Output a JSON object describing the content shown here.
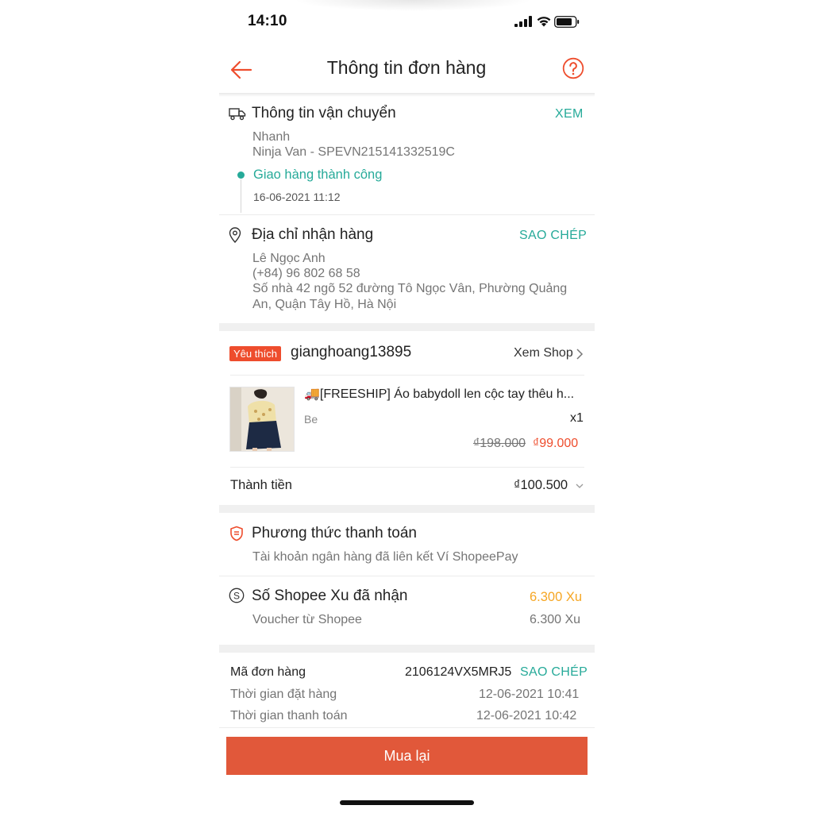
{
  "status_bar": {
    "time": "14:10"
  },
  "header": {
    "title": "Thông tin đơn hàng"
  },
  "shipping": {
    "title": "Thông tin vận chuyển",
    "action": "XEM",
    "method": "Nhanh",
    "carrier_tracking": "Ninja Van - SPEVN215141332519C",
    "status": "Giao hàng thành công",
    "status_time": "16-06-2021 11:12"
  },
  "address": {
    "title": "Địa chỉ nhận hàng",
    "action": "SAO CHÉP",
    "name": "Lê Ngọc Anh",
    "phone": "(+84) 96 802 68 58",
    "line1": "Số nhà 42 ngõ 52 đường Tô Ngọc Vân, Phường Quảng",
    "line2": "An, Quận Tây Hồ, Hà Nội"
  },
  "shop": {
    "badge": "Yêu thích",
    "name": "gianghoang13895",
    "link": "Xem Shop"
  },
  "product": {
    "name": "🚚[FREESHIP] Áo babydoll len cộc tay thêu h...",
    "variant": "Be",
    "quantity": "x1",
    "original_price": "₫198.000",
    "price": "₫99.000"
  },
  "total": {
    "label": "Thành tiền",
    "value": "₫100.500"
  },
  "payment": {
    "title": "Phương thức thanh toán",
    "method": "Tài khoản ngân hàng đã liên kết Ví ShopeePay"
  },
  "coins": {
    "title": "Số Shopee Xu đã nhận",
    "value": "6.300 Xu",
    "source_label": "Voucher từ Shopee",
    "source_value": "6.300 Xu"
  },
  "order": {
    "id_label": "Mã đơn hàng",
    "id": "2106124VX5MRJ5",
    "copy": "SAO CHÉP",
    "order_time_label": "Thời gian đặt hàng",
    "order_time": "12-06-2021 10:41",
    "pay_time_label": "Thời gian thanh toán",
    "pay_time": "12-06-2021 10:42"
  },
  "footer": {
    "button": "Mua lại"
  },
  "colors": {
    "accent": "#ee4d2d",
    "teal": "#26aa99",
    "coin": "#f6a623"
  }
}
